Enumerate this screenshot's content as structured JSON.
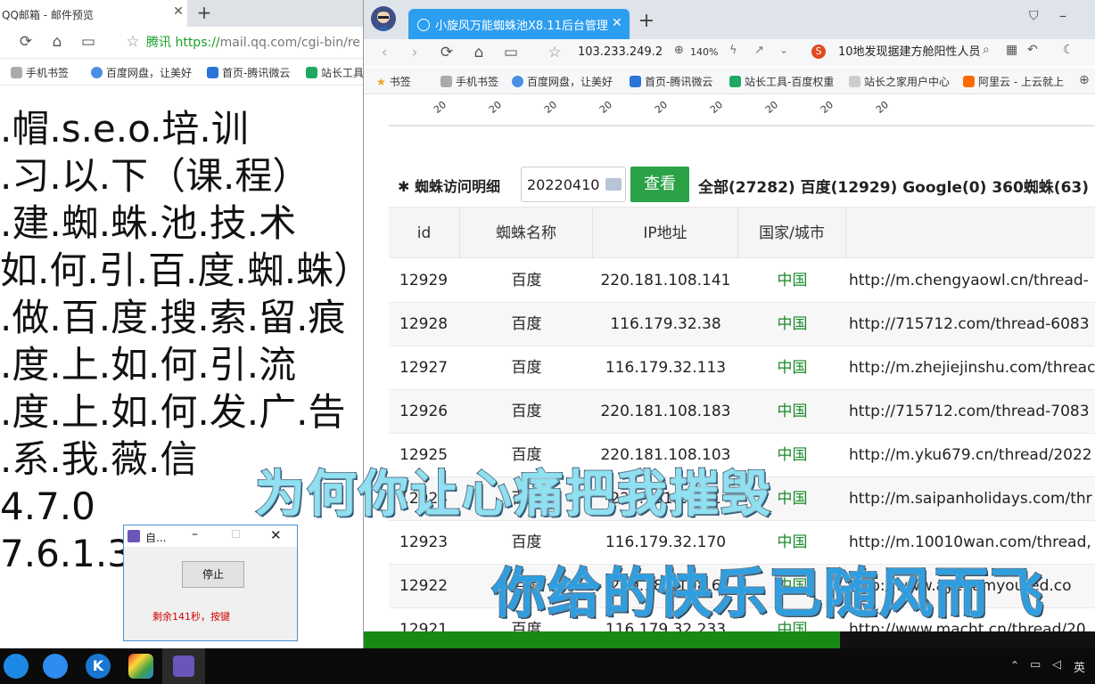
{
  "left_browser": {
    "tab_title": "QQ邮箱 - 邮件预览",
    "tab_close": "✕",
    "new_tab": "+",
    "url_site": "腾讯",
    "url_https": "https://",
    "url_rest": "mail.qq.com/cgi-bin/re",
    "bookmarks": [
      "手机书签",
      "百度网盘，让美好",
      "首页-腾讯微云",
      "站长工具"
    ]
  },
  "document_lines": [
    ".帽.s.e.o.培.训",
    ".习.以.下（课.程）",
    ".建.蜘.蛛.池.技.术",
    "如.何.引.百.度.蜘.蛛）",
    ".做.百.度.搜.索.留.痕",
    ".度.上.如.何.引.流",
    ".度.上.如.何.发.广.告",
    ".系.我.薇.信",
    "4.7.0",
    "7.6.1.3"
  ],
  "dialog": {
    "title": "自...",
    "stop_label": "停止",
    "message": "剩余141秒，按键"
  },
  "right_browser": {
    "tab_title": "小旋风万能蜘蛛池X8.11后台管理",
    "tab_close": "✕",
    "new_tab": "+",
    "address": "103.233.249.2",
    "zoom": "140%",
    "search_text": "10地发现据建方舱阳性人员",
    "bookmarks": [
      "书签",
      "手机书签",
      "百度网盘，让美好",
      "首页-腾讯微云",
      "站长工具-百度权重",
      "站长之家用户中心",
      "阿里云 - 上云就上"
    ]
  },
  "chart_strip": {
    "tick_labels": [
      "20",
      "20",
      "20",
      "20",
      "20",
      "20",
      "20",
      "20",
      "20"
    ]
  },
  "spider_panel": {
    "title": "蜘蛛访问明细",
    "date_value": "20220410",
    "query_label": "查看",
    "stats": "全部(27282)  百度(12929)  Google(0)  360蜘蛛(63)"
  },
  "table": {
    "headers": [
      "id",
      "蜘蛛名称",
      "IP地址",
      "国家/城市",
      ""
    ],
    "rows": [
      {
        "id": "12929",
        "name": "百度",
        "ip": "220.181.108.141",
        "country": "中国",
        "url": "http://m.chengyaowl.cn/thread-"
      },
      {
        "id": "12928",
        "name": "百度",
        "ip": "116.179.32.38",
        "country": "中国",
        "url": "http://715712.com/thread-6083"
      },
      {
        "id": "12927",
        "name": "百度",
        "ip": "116.179.32.113",
        "country": "中国",
        "url": "http://m.zhejiejinshu.com/threac"
      },
      {
        "id": "12926",
        "name": "百度",
        "ip": "220.181.108.183",
        "country": "中国",
        "url": "http://715712.com/thread-7083"
      },
      {
        "id": "12925",
        "name": "百度",
        "ip": "220.181.108.103",
        "country": "中国",
        "url": "http://m.yku679.cn/thread/2022"
      },
      {
        "id": "12924",
        "name": "百度",
        "ip": "220.181.108.1",
        "country": "中国",
        "url": "http://m.saipanholidays.com/thr"
      },
      {
        "id": "12923",
        "name": "百度",
        "ip": "116.179.32.170",
        "country": "中国",
        "url": "http://m.10010wan.com/thread,"
      },
      {
        "id": "12922",
        "name": "百度",
        "ip": "220.181.108.6",
        "country": "中国",
        "url": "http://www.aychamyouted.co"
      },
      {
        "id": "12921",
        "name": "百度",
        "ip": "116.179.32.233",
        "country": "中国",
        "url": "http://www.macht.cn/thread/20"
      }
    ]
  },
  "progress": {
    "fraction": 0.65
  },
  "taskbar": {
    "tray_text": "英"
  },
  "lyrics": {
    "line1": "为何你让心痛把我摧毁",
    "line2": "你给的快乐已随风而飞"
  },
  "colors": {
    "accent_tab": "#2c9ef0",
    "query_button": "#2ba245",
    "country_text": "#1a8a2a",
    "lyric1": "#8fe0f0",
    "lyric2": "#2f9ee0"
  }
}
